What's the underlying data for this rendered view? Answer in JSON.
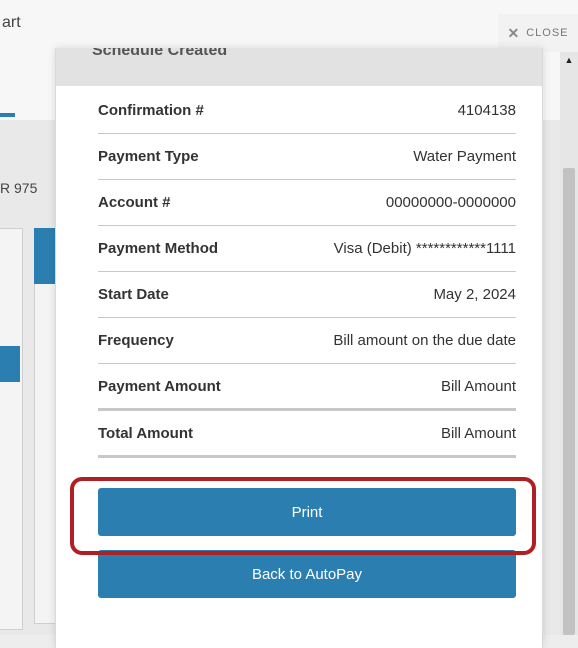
{
  "background": {
    "cart_text": "art",
    "account_text": "R 975"
  },
  "close_button": {
    "label": "CLOSE"
  },
  "modal": {
    "header_title": "Schedule Created",
    "rows": [
      {
        "label": "Confirmation #",
        "value": "4104138"
      },
      {
        "label": "Payment Type",
        "value": "Water Payment"
      },
      {
        "label": "Account #",
        "value": "00000000-0000000"
      },
      {
        "label": "Payment Method",
        "value": "Visa (Debit) ************1111"
      },
      {
        "label": "Start Date",
        "value": "May 2, 2024"
      },
      {
        "label": "Frequency",
        "value": "Bill amount on the due date"
      },
      {
        "label": "Payment Amount",
        "value": "Bill Amount"
      },
      {
        "label": "Total Amount",
        "value": "Bill Amount"
      }
    ],
    "print_label": "Print",
    "back_label": "Back to AutoPay"
  },
  "colors": {
    "accent": "#2a7fb0",
    "highlight": "#b01f24"
  }
}
